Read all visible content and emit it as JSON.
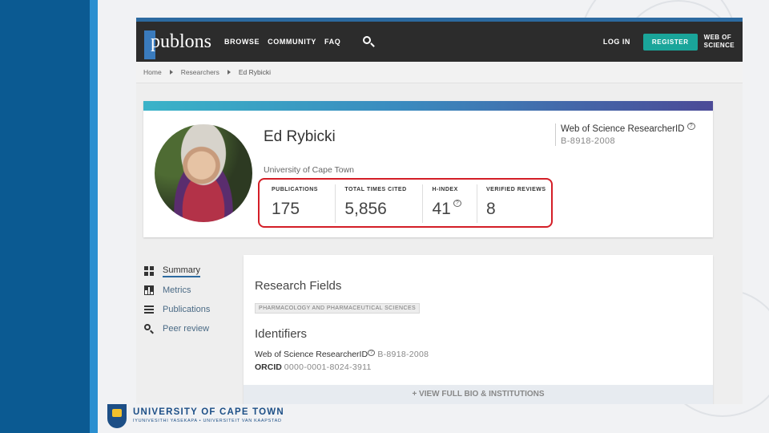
{
  "header": {
    "logo_text": "publons",
    "nav": [
      "BROWSE",
      "COMMUNITY",
      "FAQ"
    ],
    "login_label": "LOG IN",
    "register_label": "REGISTER",
    "wos_line1": "WEB OF",
    "wos_line2": "SCIENCE"
  },
  "breadcrumb": [
    "Home",
    "Researchers",
    "Ed Rybicki"
  ],
  "profile": {
    "name": "Ed Rybicki",
    "affiliation": "University of Cape Town",
    "researcher_id_label": "Web of Science ResearcherID",
    "researcher_id": "B-8918-2008",
    "help_mark": "?"
  },
  "stats": [
    {
      "label": "PUBLICATIONS",
      "value": "175"
    },
    {
      "label": "TOTAL TIMES CITED",
      "value": "5,856"
    },
    {
      "label": "H-INDEX",
      "value": "41"
    },
    {
      "label": "VERIFIED REVIEWS",
      "value": "8"
    }
  ],
  "sidenav": [
    "Summary",
    "Metrics",
    "Publications",
    "Peer review"
  ],
  "details": {
    "research_fields_title": "Research Fields",
    "research_field_tag": "PHARMACOLOGY AND PHARMACEUTICAL SCIENCES",
    "identifiers_title": "Identifiers",
    "wos_id_label": "Web of Science ResearcherID",
    "wos_id_value": "B-8918-2008",
    "orcid_label": "ORCID",
    "orcid_value": "0000-0001-8024-3911",
    "view_full": "+ VIEW FULL BIO & INSTITUTIONS"
  },
  "footer": {
    "institution": "UNIVERSITY OF CAPE TOWN",
    "tagline": "IYUNIVESITHI YASEKAPA • UNIVERSITEIT VAN KAAPSTAD"
  },
  "colors": {
    "slide_band": "#0b5a92",
    "nav_bg": "#2c2c2c",
    "register_bg": "#1aa59a",
    "highlight_border": "#d41e27"
  }
}
